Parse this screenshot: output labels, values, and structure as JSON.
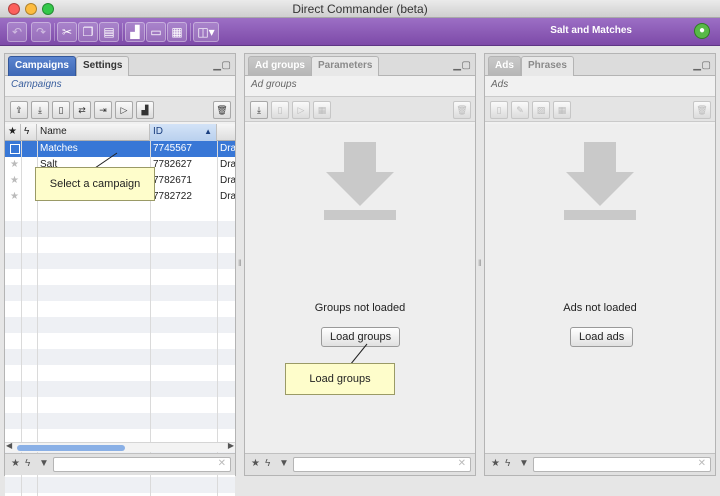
{
  "window": {
    "title": "Direct Commander (beta)"
  },
  "toolbar": {
    "buttons": [
      {
        "icon": "undo-icon"
      },
      {
        "icon": "redo-icon"
      },
      {
        "icon": "cut-icon"
      },
      {
        "icon": "copy-icon"
      },
      {
        "icon": "paste-icon"
      },
      {
        "icon": "stats-icon"
      },
      {
        "icon": "tag-icon"
      },
      {
        "icon": "calculator-icon"
      },
      {
        "icon": "view-menu-icon"
      }
    ],
    "app_name": "Salt and Matches"
  },
  "campaigns_panel": {
    "tabs": [
      "Campaigns",
      "Settings"
    ],
    "subtitle": "Campaigns",
    "columns": [
      "Name",
      "ID"
    ],
    "sort_indicator": "▲",
    "rows": [
      {
        "name": "Matches",
        "id": "7745567",
        "status": "Dra",
        "selected": true
      },
      {
        "name": "Salt",
        "id": "7782627",
        "status": "Dra"
      },
      {
        "name": "",
        "id": "7782671",
        "status": "Dra"
      },
      {
        "name": "",
        "id": "7782722",
        "status": "Dra"
      }
    ],
    "tooltip": "Select a campaign"
  },
  "groups_panel": {
    "tabs": [
      "Ad groups",
      "Parameters"
    ],
    "subtitle": "Ad groups",
    "empty_text": "Groups not loaded",
    "load_button": "Load groups",
    "tooltip": "Load groups"
  },
  "ads_panel": {
    "tabs": [
      "Ads",
      "Phrases"
    ],
    "subtitle": "Ads",
    "empty_text": "Ads not loaded",
    "load_button": "Load ads"
  },
  "colors": {
    "toolbar": "#8a5ab5",
    "selection": "#3877d6",
    "tooltip_bg": "#fefdcb"
  }
}
